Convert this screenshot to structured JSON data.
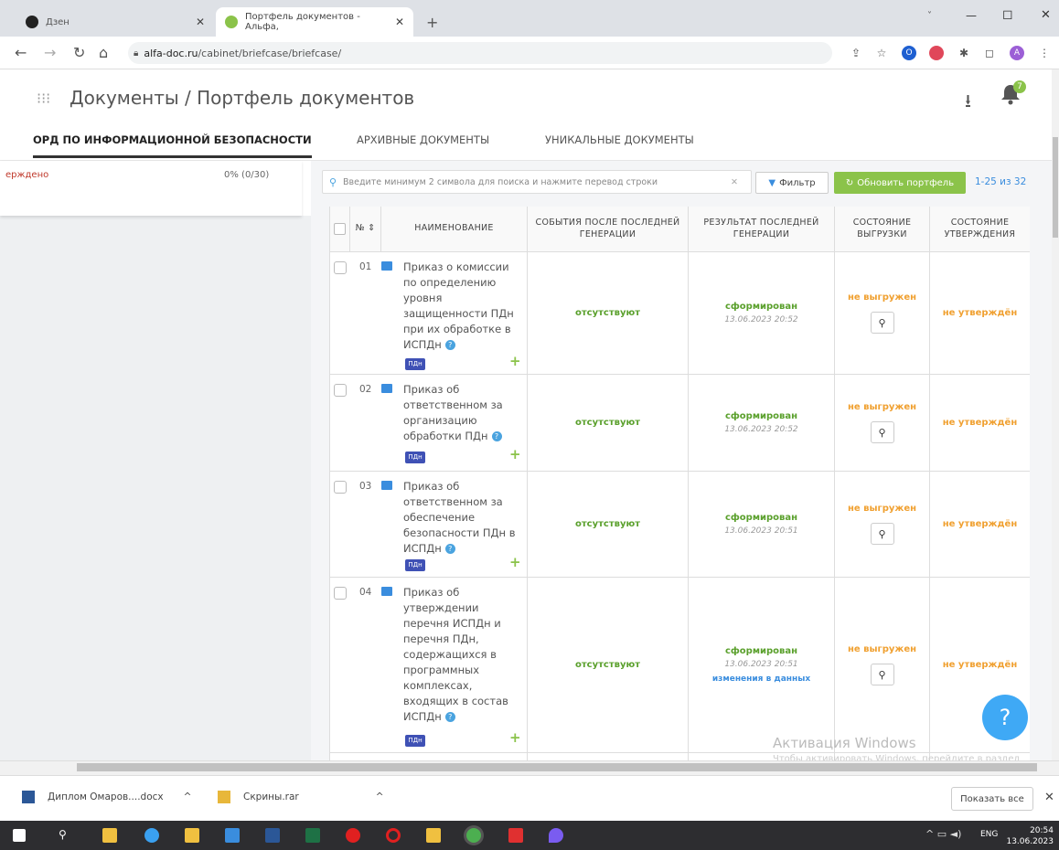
{
  "browser": {
    "tabs": [
      {
        "title": "Дзен",
        "active": false
      },
      {
        "title": "Портфель документов - Альфа,",
        "active": true
      }
    ],
    "new_tab": "+",
    "url_domain": "alfa-doc.ru",
    "url_path": "/cabinet/briefcase/briefcase/",
    "window_controls": [
      "˅",
      "—",
      "◻",
      "✕"
    ]
  },
  "header": {
    "breadcrumb": "Документы / Портфель документов",
    "notification_count": "7"
  },
  "doc_tabs": [
    {
      "label": "ОРД ПО ИНФОРМАЦИОННОЙ БЕЗОПАСНОСТИ",
      "active": true
    },
    {
      "label": "АРХИВНЫЕ ДОКУМЕНТЫ",
      "active": false
    },
    {
      "label": "УНИКАЛЬНЫЕ ДОКУМЕНТЫ",
      "active": false
    }
  ],
  "left_panel": {
    "status": "ерждено",
    "progress": "0% (0/30)"
  },
  "toolbar": {
    "search_placeholder": "Введите минимум 2 символа для поиска и нажмите перевод строки",
    "filter_label": "Фильтр",
    "refresh_label": "Обновить портфель",
    "count": "1-25 из 32"
  },
  "table": {
    "headers": [
      "№ ⇕",
      "НАИМЕНОВАНИЕ",
      "СОБЫТИЯ ПОСЛЕ ПОСЛЕДНЕЙ ГЕНЕРАЦИИ",
      "РЕЗУЛЬТАТ ПОСЛЕДНЕЙ ГЕНЕРАЦИИ",
      "СОСТОЯНИЕ ВЫГРУЗКИ",
      "СОСТОЯНИЕ УТВЕРЖДЕНИЯ"
    ],
    "rows": [
      {
        "num": "01",
        "title": "Приказ о комиссии по определению уровня защищенности ПДн при их обработке в ИСПДн",
        "tag": "ПДн",
        "events": "отсутствуют",
        "result": "сформирован",
        "date": "13.06.2023 20:52",
        "changes": "",
        "upload": "не выгружен",
        "approval": "не утверждён"
      },
      {
        "num": "02",
        "title": "Приказ об ответственном за организацию обработки ПДн",
        "tag": "ПДн",
        "events": "отсутствуют",
        "result": "сформирован",
        "date": "13.06.2023 20:52",
        "changes": "",
        "upload": "не выгружен",
        "approval": "не утверждён"
      },
      {
        "num": "03",
        "title": "Приказ об ответственном за обеспечение безопасности ПДн в ИСПДн",
        "tag": "ПДн",
        "events": "отсутствуют",
        "result": "сформирован",
        "date": "13.06.2023 20:51",
        "changes": "",
        "upload": "не выгружен",
        "approval": "не утверждён"
      },
      {
        "num": "04",
        "title": "Приказ об утверждении перечня ИСПДн и перечня ПДн, содержащихся в программных комплексах, входящих в состав ИСПДн",
        "tag": "ПДн",
        "events": "отсутствуют",
        "result": "сформирован",
        "date": "13.06.2023 20:51",
        "changes": "изменения в данных",
        "upload": "не выгружен",
        "approval": "не утверждён"
      }
    ]
  },
  "help_label": "?",
  "watermark": {
    "line1": "Активация Windows",
    "line2": "Чтобы активировать Windows, перейдите в раздел \"Параметры\"."
  },
  "downloads": {
    "items": [
      "Диплом Омаров....docx",
      "Скрины.rar"
    ],
    "show_all": "Показать все"
  },
  "taskbar": {
    "lang": "ENG",
    "time": "20:54",
    "date": "13.06.2023"
  }
}
